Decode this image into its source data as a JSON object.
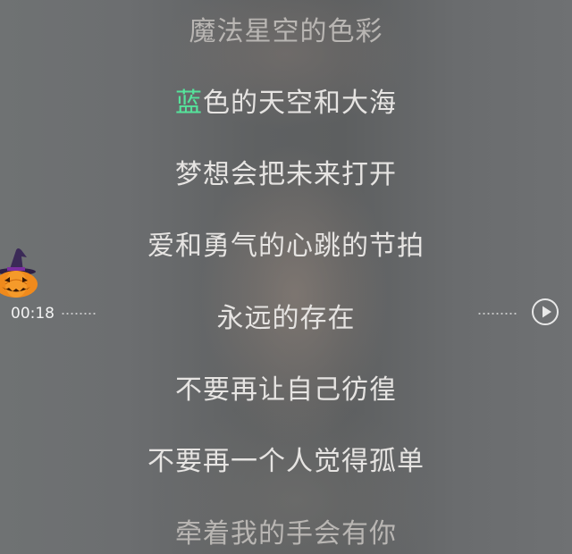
{
  "lyrics": {
    "lines": [
      "魔法星空的色彩",
      "蓝色的天空和大海",
      "梦想会把未来打开",
      "爱和勇气的心跳的节拍",
      "永远的存在",
      "不要再让自己彷徨",
      "不要再一个人觉得孤单",
      "牵着我的手会有你"
    ],
    "current": {
      "sung": "蓝",
      "rest": "色的天空和大海"
    }
  },
  "player": {
    "seek_time": "00:18",
    "play_icon": "play-circle-icon",
    "seek_avatar_icon": "halloween-pumpkin-icon"
  },
  "colors": {
    "highlight": "#55e39b",
    "lyric_text": "#e6e4e2"
  }
}
